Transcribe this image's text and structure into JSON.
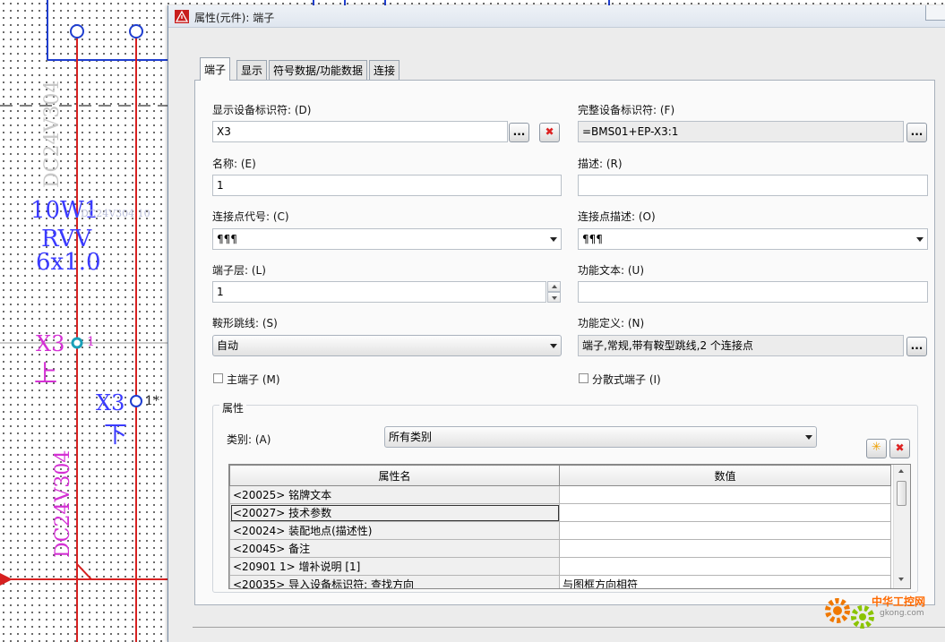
{
  "cad": {
    "cable_id": "10W1",
    "cable_type": "RVV",
    "cable_spec": "6x1.0",
    "cable_faint": "DC24V304 10",
    "vertical_label_top": "DC24V304",
    "vertical_label_bottom": "DC24V304",
    "term_upper": "X3",
    "term_upper_sub": "上",
    "term_upper_pin": "1",
    "term_lower": "X3",
    "term_lower_sub": "下",
    "term_lower_pin": "1*"
  },
  "window": {
    "title": "属性(元件): 端子"
  },
  "tabs": [
    {
      "label": "端子",
      "active": true
    },
    {
      "label": "显示",
      "active": false
    },
    {
      "label": "符号数据/功能数据",
      "active": false
    },
    {
      "label": "连接",
      "active": false
    }
  ],
  "form": {
    "display_id_label": "显示设备标识符: (D)",
    "display_id_value": "X3",
    "full_id_label": "完整设备标识符: (F)",
    "full_id_value": "=BMS01+EP-X3:1",
    "name_label": "名称: (E)",
    "name_value": "1",
    "desc_label": "描述: (R)",
    "desc_value": "",
    "conn_code_label": "连接点代号: (C)",
    "conn_code_value": "¶¶¶",
    "conn_desc_label": "连接点描述: (O)",
    "conn_desc_value": "¶¶¶",
    "layer_label": "端子层: (L)",
    "layer_value": "1",
    "func_text_label": "功能文本: (U)",
    "func_text_value": "",
    "jumper_label": "鞍形跳线: (S)",
    "jumper_value": "自动",
    "func_def_label": "功能定义: (N)",
    "func_def_value": "端子,常规,带有鞍型跳线,2 个连接点",
    "main_terminal_label": "主端子 (M)",
    "main_terminal_checked": false,
    "distributed_label": "分散式端子 (I)",
    "distributed_checked": false,
    "browse": "...",
    "clear": "✖"
  },
  "properties": {
    "group_title": "属性",
    "category_label": "类别: (A)",
    "category_value": "所有类别",
    "col_name": "属性名",
    "col_value": "数值",
    "rows": [
      {
        "name": "<20025> 铭牌文本",
        "value": ""
      },
      {
        "name": "<20027> 技术参数",
        "value": ""
      },
      {
        "name": "<20024> 装配地点(描述性)",
        "value": ""
      },
      {
        "name": "<20045> 备注",
        "value": ""
      },
      {
        "name": "<20901 1> 增补说明 [1]",
        "value": ""
      },
      {
        "name": "<20035> 导入设备标识符: 查找方向",
        "value": "与图框方向相符"
      }
    ]
  },
  "watermark": {
    "text": "中华工控网",
    "url": "gkong.com"
  },
  "colors": {
    "wire_red": "#d62020",
    "wire_blue": "#1f3ecf",
    "label_magenta": "#d431d4",
    "label_blue": "#3b3bff",
    "terminal_cyan": "#1aa0b8"
  }
}
